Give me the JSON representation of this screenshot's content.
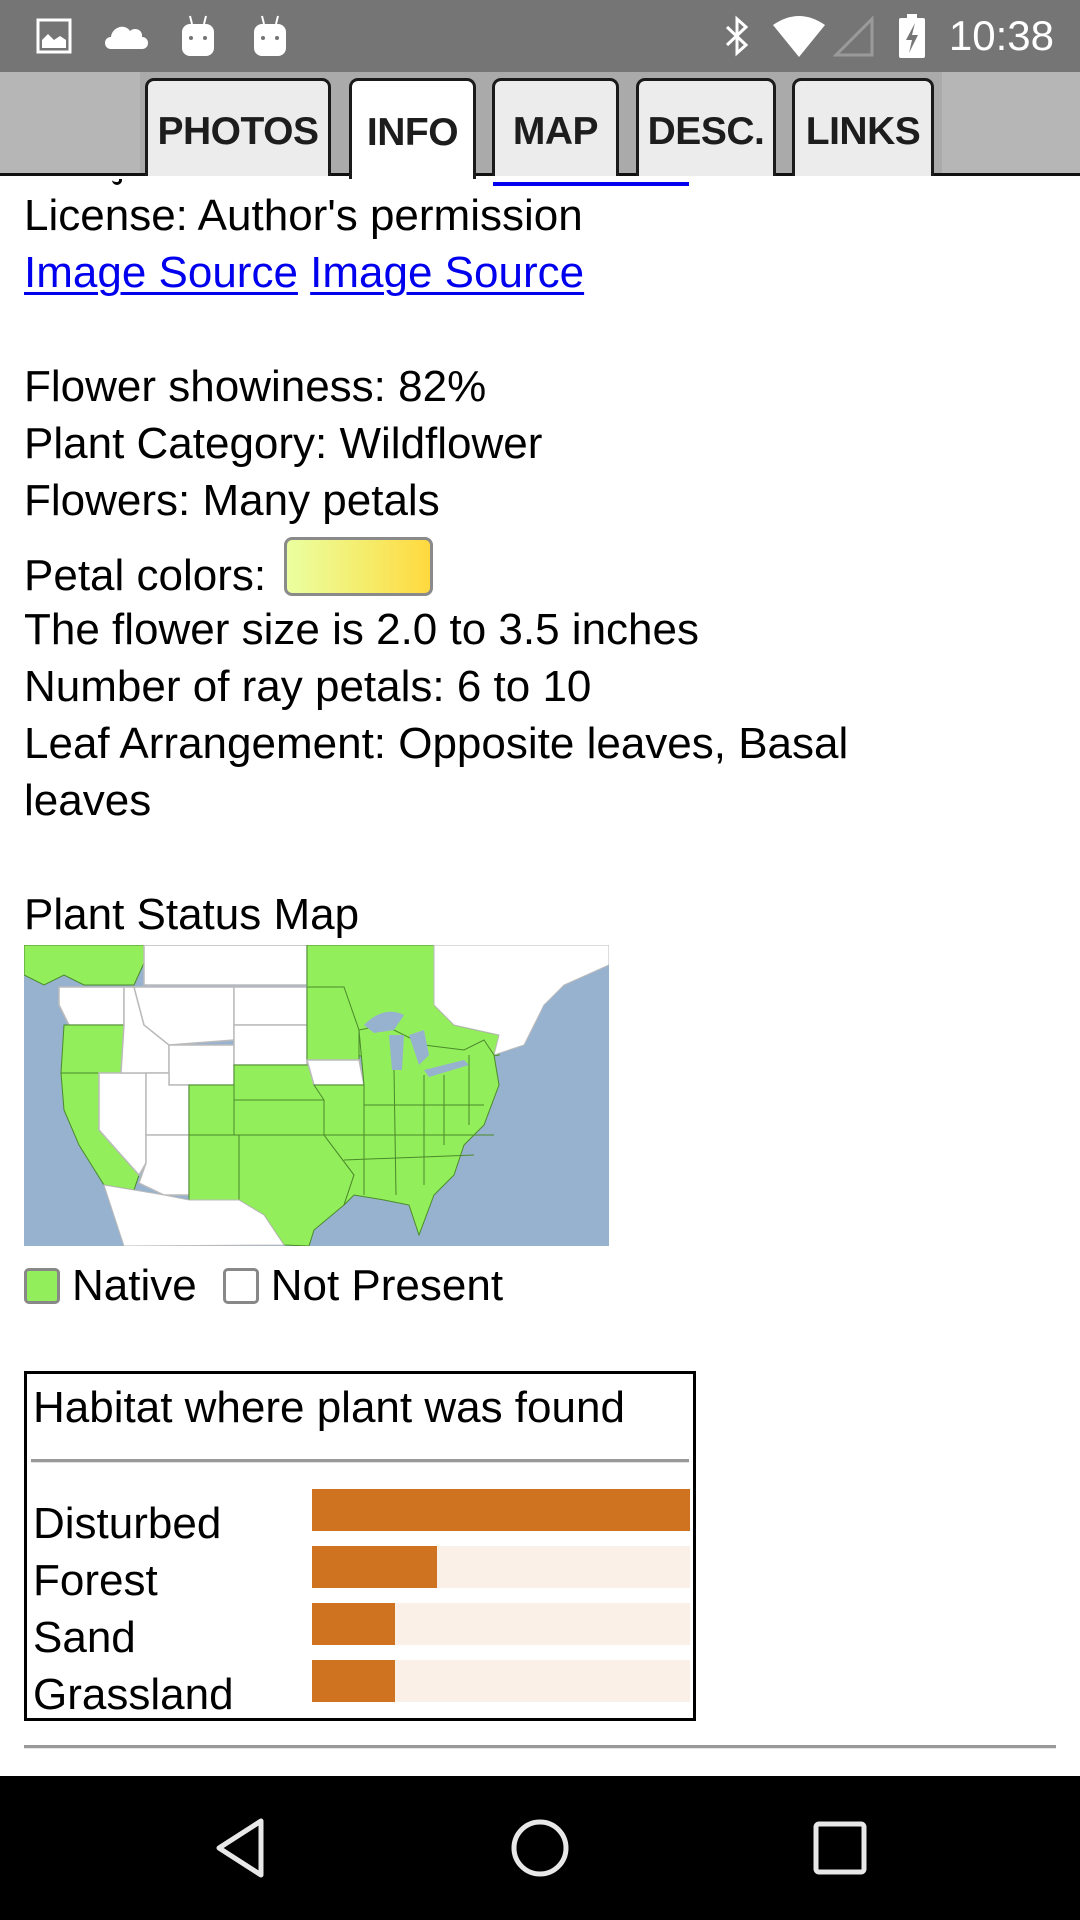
{
  "status_bar": {
    "left_icons": [
      "image-notification-icon",
      "cloud-icon",
      "android-icon",
      "android-icon"
    ],
    "right_icons": [
      "bluetooth-icon",
      "wifi-icon",
      "cell-signal-icon",
      "battery-charging-icon"
    ],
    "time": "10:38"
  },
  "tabs": [
    {
      "label": "PHOTOS",
      "active": false
    },
    {
      "label": "INFO",
      "active": true
    },
    {
      "label": "MAP",
      "active": false
    },
    {
      "label": "DESC.",
      "active": false
    },
    {
      "label": "LINKS",
      "active": false
    }
  ],
  "info": {
    "license": "License: Author's permission",
    "image_source_links": [
      "Image Source",
      "Image Source"
    ],
    "showiness": "Flower showiness: 82%",
    "category": "Plant Category: Wildflower",
    "flowers": "Flowers: Many petals",
    "petal_colors_label": "Petal colors:",
    "petal_colors": [
      "#eaffa0",
      "#f4ee70",
      "#ffd93e"
    ],
    "flower_size": "The flower size is 2.0 to 3.5 inches",
    "ray_petals": "Number of ray petals: 6 to 10",
    "leaf_arrangement_line1": "Leaf Arrangement: Opposite leaves, Basal",
    "leaf_arrangement_line2": "leaves"
  },
  "status_map": {
    "title": "Plant Status Map",
    "colors": {
      "native": "#93ee5c",
      "not_present": "#ffffff",
      "water": "#97b2cf"
    },
    "legend": [
      {
        "label": "Native",
        "color": "#93ee5c"
      },
      {
        "label": "Not Present",
        "color": "#ffffff"
      }
    ]
  },
  "habitat": {
    "title": "Habitat where plant was found",
    "bar_color": "#cf7320",
    "track_color": "#fbf0e7",
    "rows": [
      {
        "label": "Disturbed",
        "value": 1.0
      },
      {
        "label": "Forest",
        "value": 0.33
      },
      {
        "label": "Sand",
        "value": 0.22
      },
      {
        "label": "Grassland",
        "value": 0.22
      }
    ]
  },
  "nav_bar": {
    "buttons": [
      "back",
      "home",
      "recents"
    ]
  }
}
